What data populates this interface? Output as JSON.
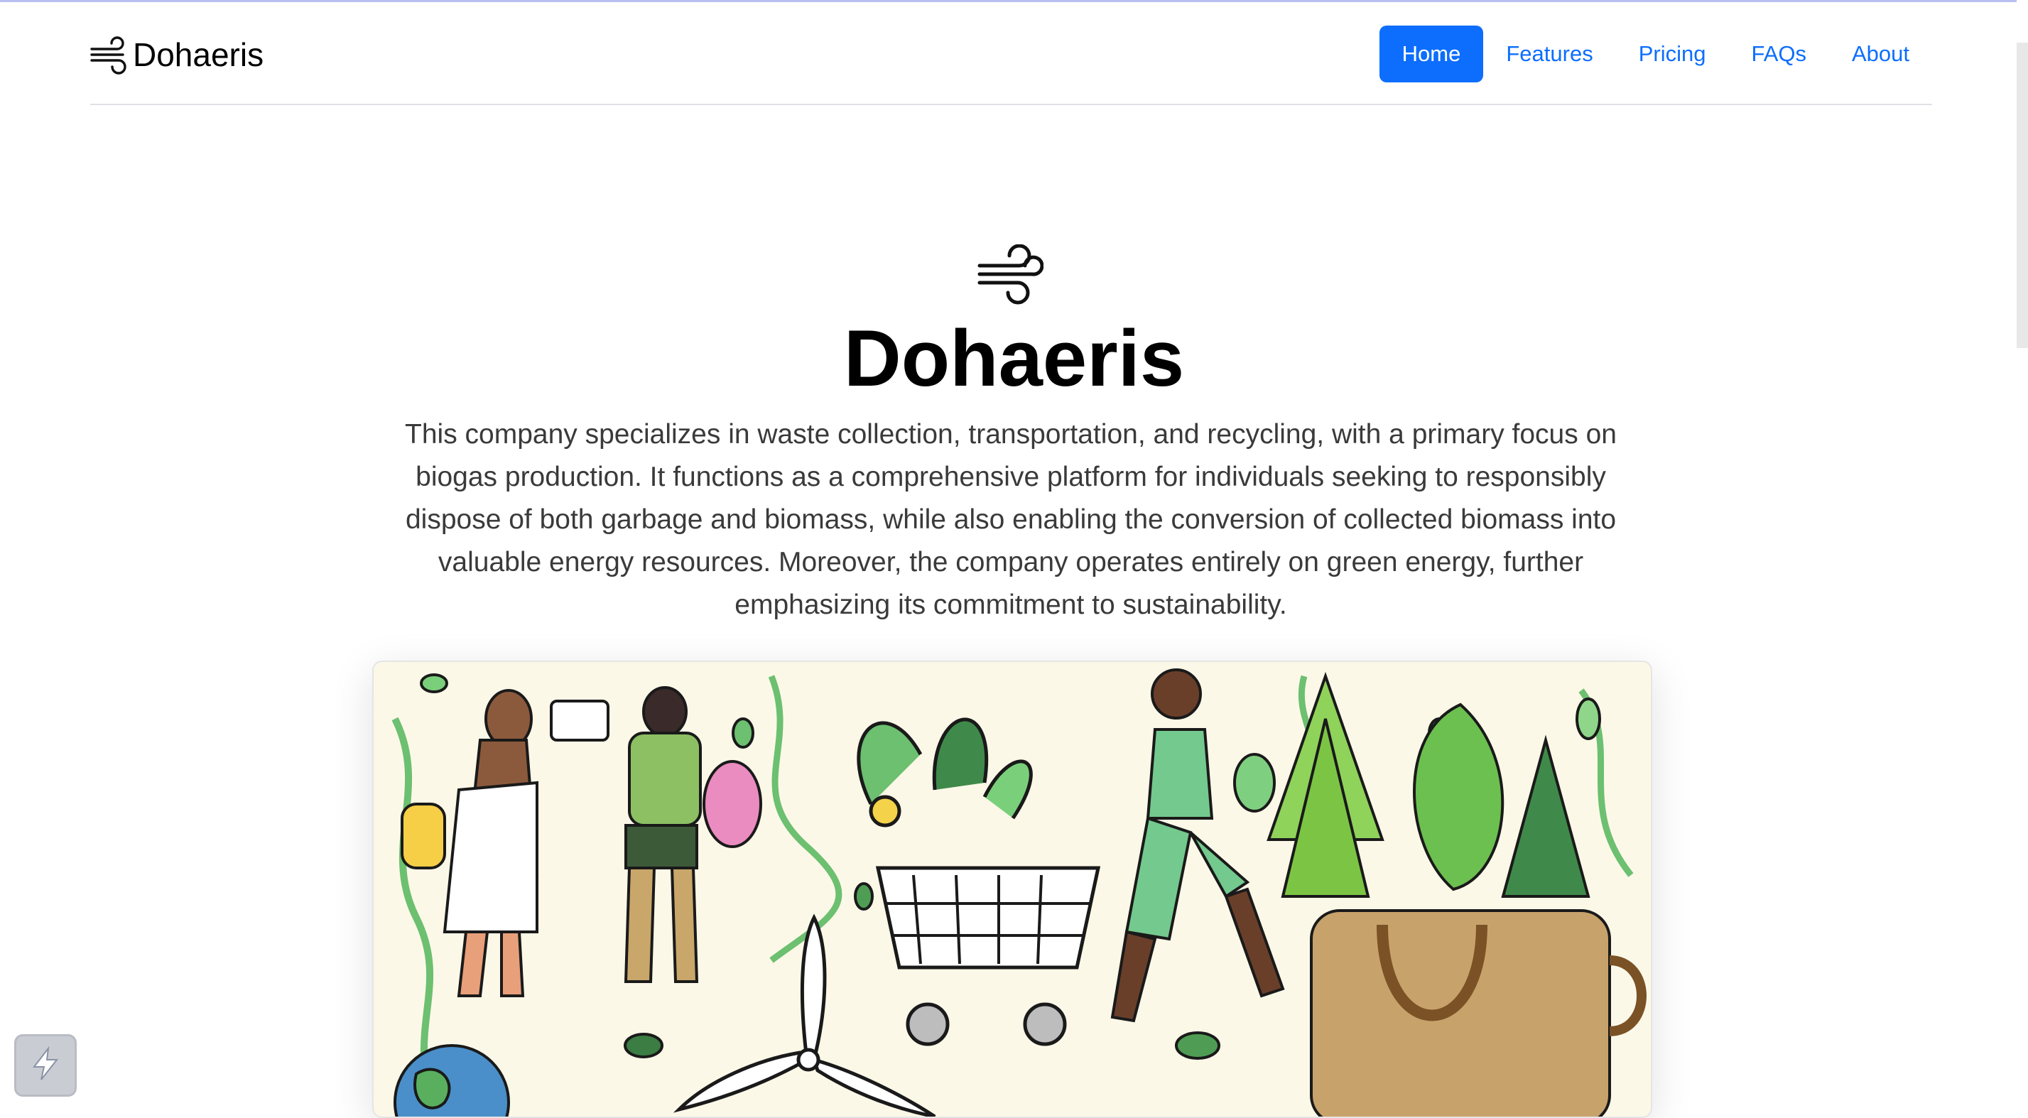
{
  "brand": {
    "name": "Dohaeris",
    "icon": "wind-icon"
  },
  "nav": {
    "items": [
      {
        "label": "Home",
        "active": true
      },
      {
        "label": "Features",
        "active": false
      },
      {
        "label": "Pricing",
        "active": false
      },
      {
        "label": "FAQs",
        "active": false
      },
      {
        "label": "About",
        "active": false
      }
    ]
  },
  "hero": {
    "icon": "wind-icon",
    "title": "Dohaeris",
    "lead": "This company specializes in waste collection, transportation, and recycling, with a primary focus on biogas production. It functions as a comprehensive platform for individuals seeking to responsibly dispose of both garbage and biomass, while also enabling the conversion of collected biomass into valuable energy resources. Moreover, the company operates entirely on green energy, further emphasizing its commitment to sustainability.",
    "image": "eco-lifestyle-illustration"
  },
  "floating_widget": {
    "icon": "lightning-icon"
  },
  "colors": {
    "accent": "#0d6efd",
    "text": "#000000",
    "lead": "#3a3a3a",
    "divider": "#dee2e6"
  }
}
